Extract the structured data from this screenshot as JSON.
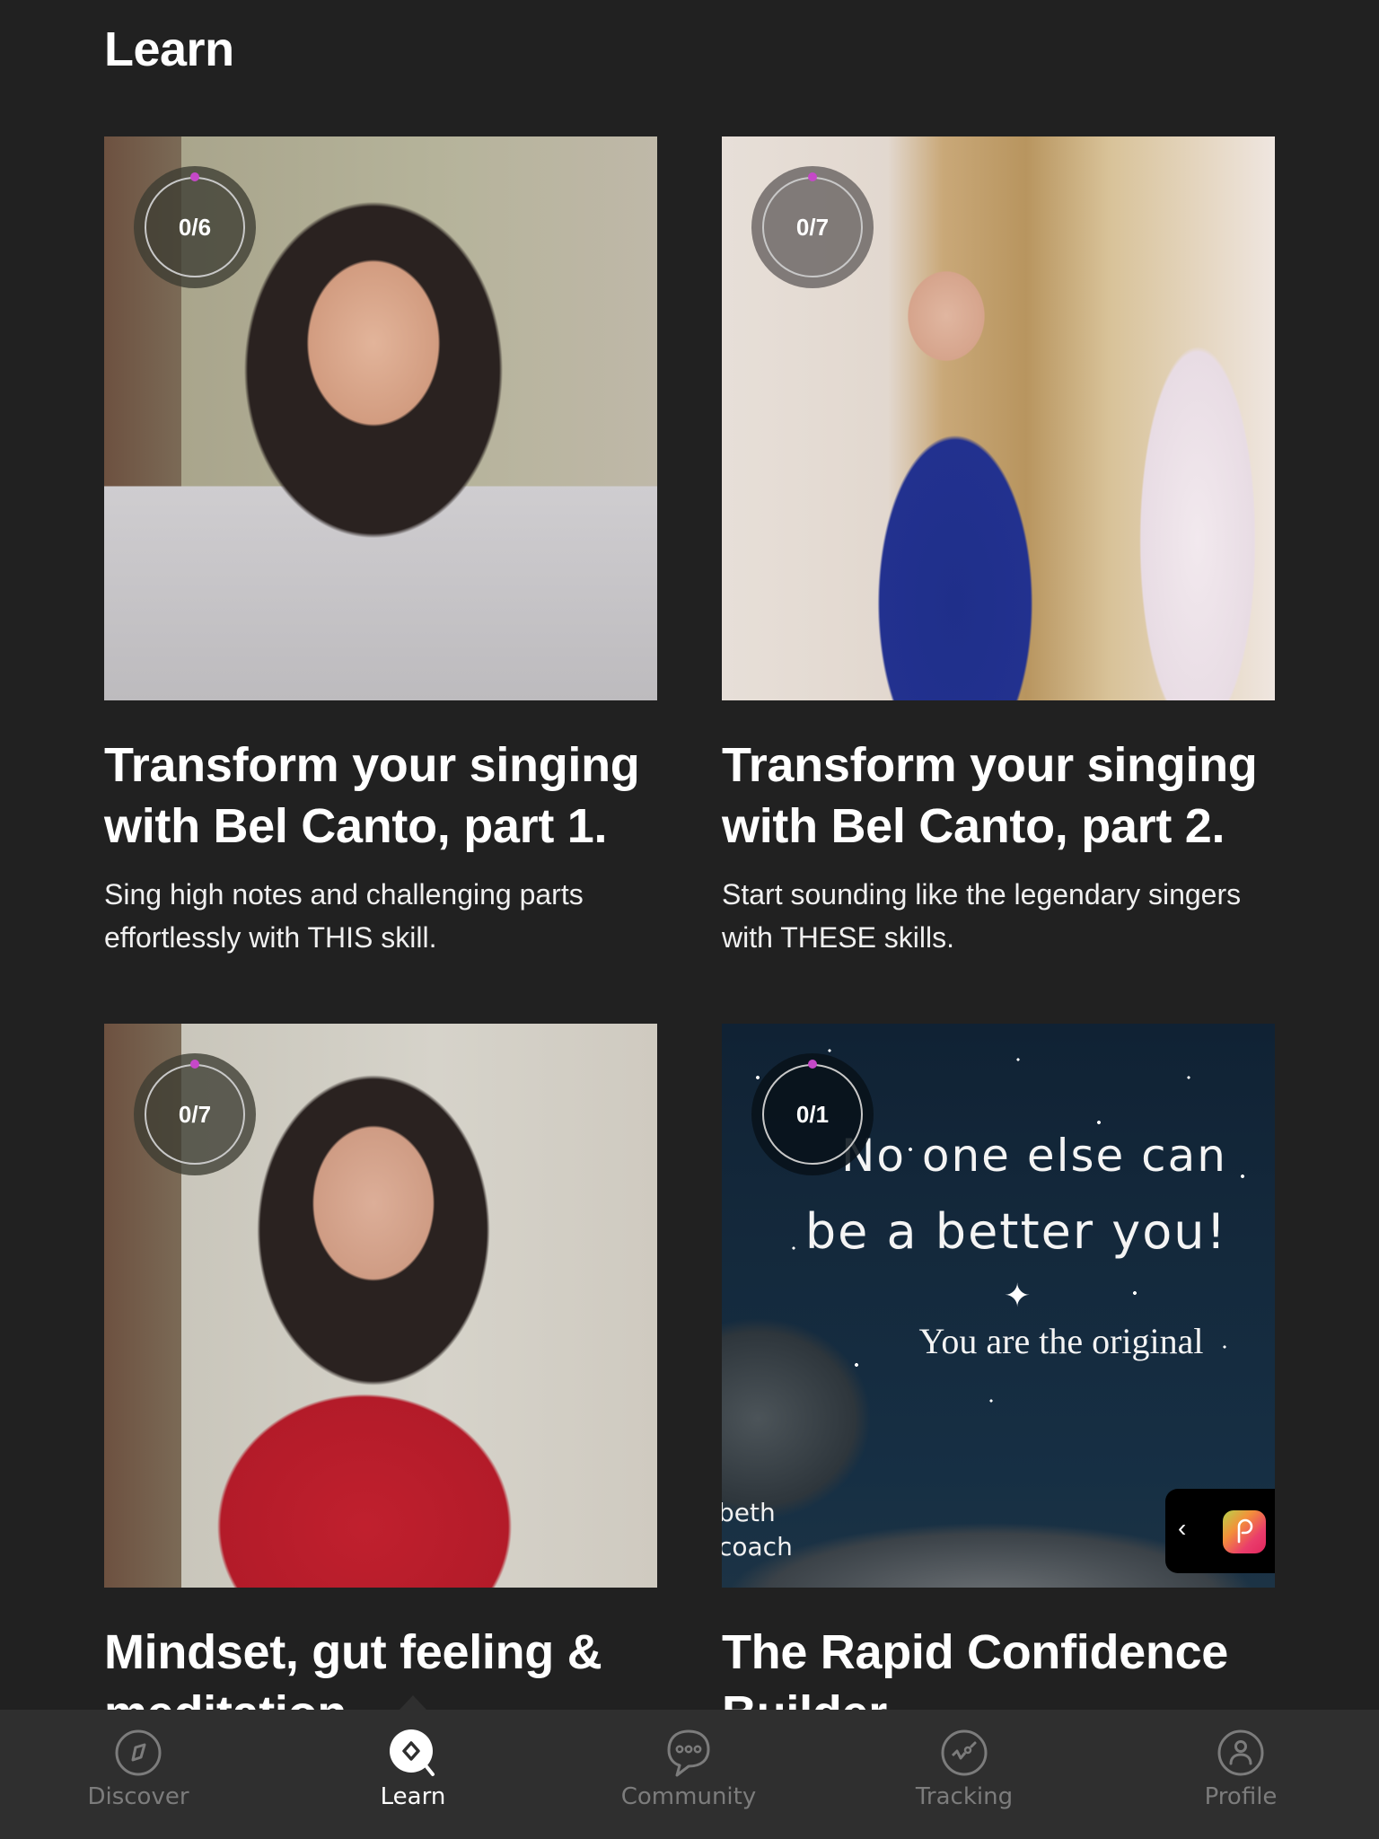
{
  "header": {
    "title": "Learn"
  },
  "courses": [
    {
      "progress_label": "0/6",
      "progress": {
        "completed": 0,
        "total": 6
      },
      "title": "Transform your singing with Bel Canto, part 1.",
      "description": "Sing high notes and challenging parts effortlessly with THIS skill."
    },
    {
      "progress_label": "0/7",
      "progress": {
        "completed": 0,
        "total": 7
      },
      "title": "Transform your singing with Bel Canto, part 2.",
      "description": "Start sounding like the legendary singers with THESE skills."
    },
    {
      "progress_label": "0/7",
      "progress": {
        "completed": 0,
        "total": 7
      },
      "title": "Mindset, gut feeling & meditation",
      "description": ""
    },
    {
      "progress_label": "0/1",
      "progress": {
        "completed": 0,
        "total": 1
      },
      "title": "The Rapid Confidence Builder",
      "description": "",
      "thumbnail_text": {
        "line1": "No one else can",
        "line2": "be a better you!",
        "line3": "You are the original",
        "signature1": "beth",
        "signature2": "coach"
      }
    }
  ],
  "app_switcher": {
    "back_glyph": "‹",
    "icon": "app-logo-icon"
  },
  "bottom_nav": {
    "items": [
      {
        "label": "Discover",
        "icon": "compass-icon",
        "active": false
      },
      {
        "label": "Learn",
        "icon": "learn-search-icon",
        "active": true
      },
      {
        "label": "Community",
        "icon": "chat-bubble-icon",
        "active": false
      },
      {
        "label": "Tracking",
        "icon": "tracking-chart-icon",
        "active": false
      },
      {
        "label": "Profile",
        "icon": "profile-icon",
        "active": false
      }
    ]
  },
  "colors": {
    "background": "#212121",
    "nav_background": "#2f2f2f",
    "progress_accent": "#c548c8",
    "nav_inactive": "#7c7c7c",
    "nav_active": "#ffffff"
  }
}
